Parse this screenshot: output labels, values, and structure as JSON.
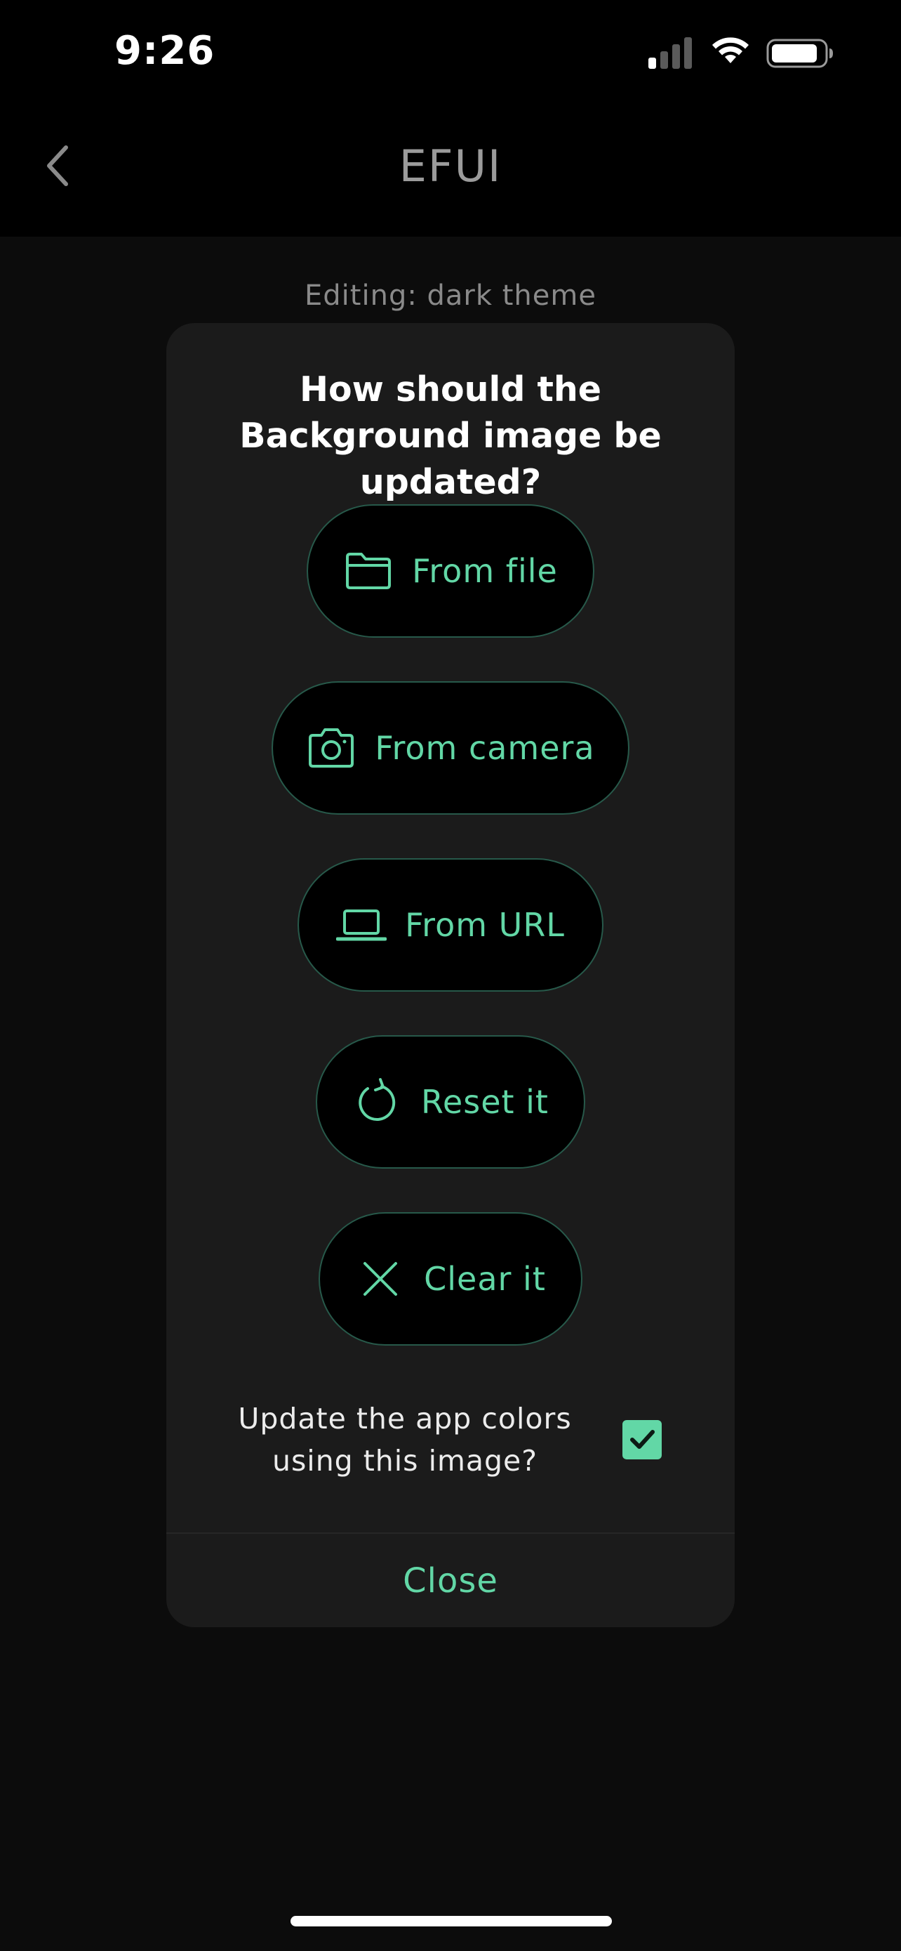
{
  "status_bar": {
    "time": "9:26"
  },
  "nav": {
    "title": "EFUI",
    "back_icon": "chevron-left-icon"
  },
  "page": {
    "editing_label": "Editing: dark theme"
  },
  "dialog": {
    "title": "How should the Background image be updated?",
    "options": [
      {
        "label": "From file",
        "icon": "folder-icon"
      },
      {
        "label": "From camera",
        "icon": "camera-icon"
      },
      {
        "label": "From URL",
        "icon": "laptop-icon"
      },
      {
        "label": "Reset it",
        "icon": "refresh-icon"
      },
      {
        "label": "Clear it",
        "icon": "close-icon"
      }
    ],
    "checkbox_label": "Update the app colors using this image?",
    "checkbox_checked": true,
    "close_label": "Close"
  },
  "colors": {
    "accent": "#62d7a6",
    "button_border": "#27594a",
    "dialog_bg": "#1b1b1b",
    "page_bg": "#0c0c0c"
  }
}
